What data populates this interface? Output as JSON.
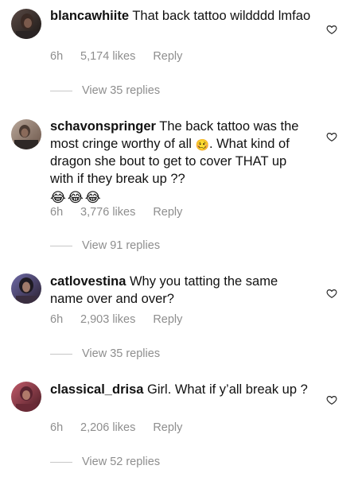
{
  "comments": [
    {
      "username": "blancawhiite",
      "text": "That back tattoo wildddd lmfao",
      "time": "6h",
      "likes": "5,174 likes",
      "reply_label": "Reply",
      "view_replies": "View 35 replies",
      "avatar_icon": "avatar-photo"
    },
    {
      "username": "schavonspringer",
      "text": "The back tattoo was the most cringe worthy of all",
      "text_2": ". What kind of dragon she bout to get to cover THAT up with if they break up ??",
      "inline_emoji": "🥴",
      "trailing_emojis": [
        "😂",
        "😂",
        "😂"
      ],
      "time": "6h",
      "likes": "3,776 likes",
      "reply_label": "Reply",
      "view_replies": "View 91 replies",
      "avatar_icon": "avatar-photo"
    },
    {
      "username": "catlovestina",
      "text": "Why you tatting the same name over and over?",
      "time": "6h",
      "likes": "2,903 likes",
      "reply_label": "Reply",
      "view_replies": "View 35 replies",
      "avatar_icon": "avatar-photo"
    },
    {
      "username": "classical_drisa",
      "text": "Girl. What if y’all break up ?",
      "time": "6h",
      "likes": "2,206 likes",
      "reply_label": "Reply",
      "view_replies": "View 52 replies",
      "avatar_icon": "avatar-photo"
    }
  ],
  "icons": {
    "like": "heart-outline-icon"
  },
  "colors": {
    "text": "#111111",
    "meta": "#8e8e8e",
    "divider": "#c7c7c7"
  }
}
